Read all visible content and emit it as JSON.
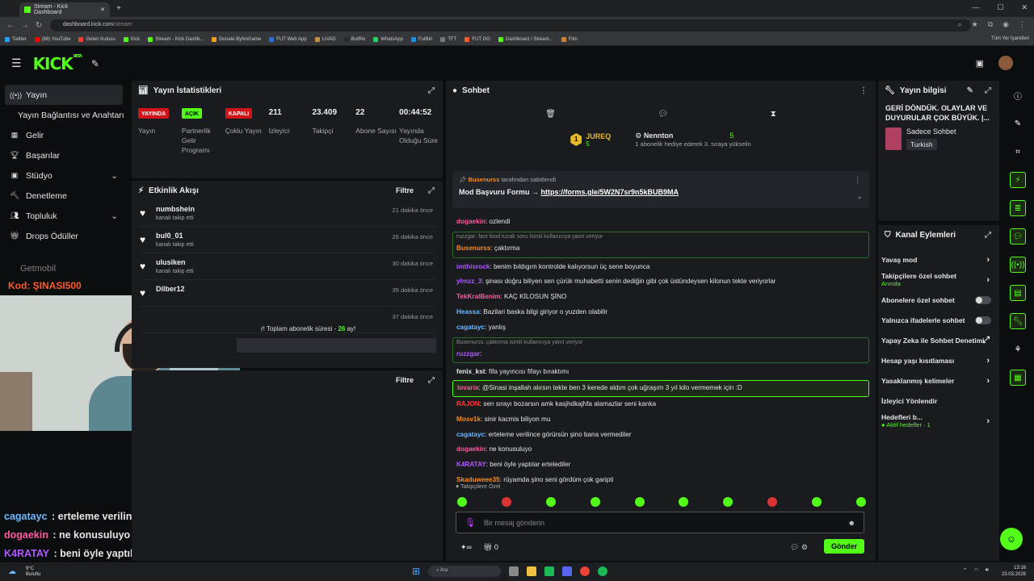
{
  "browser": {
    "tab_title": "Stream - Kick Dashboard",
    "url_host": "dashboard.kick.com",
    "url_path": "/stream",
    "bookmarks": [
      "Twitter",
      "(88) YouTube",
      "Gelen Kutusu",
      "Kick",
      "Stream - Kick Dashb...",
      "Donate ByNoGame",
      "FUT Web App",
      "LIVAD",
      "BotRix",
      "WhatsApp",
      "FutBin",
      "TFT",
      "FUT GG",
      "Dashboard / Stream...",
      "Film"
    ],
    "all_bookmarks": "Tüm Yer İşaretleri"
  },
  "header": {
    "logo": "KICK",
    "beta": "BETA"
  },
  "sidebar": {
    "items": [
      {
        "label": "Yayın",
        "icon": "broadcast-icon"
      },
      {
        "label": "Yayın Bağlantısı ve Anahtarı",
        "icon": ""
      },
      {
        "label": "Gelir",
        "icon": "revenue-icon"
      },
      {
        "label": "Başarılar",
        "icon": "trophy-icon"
      },
      {
        "label": "Stüdyo",
        "icon": "studio-icon"
      },
      {
        "label": "Denetleme",
        "icon": "hammer-icon"
      },
      {
        "label": "Topluluk",
        "icon": "community-icon"
      },
      {
        "label": "Drops Ödüller",
        "icon": "gift-icon"
      }
    ],
    "promo_brand": "Getmobil",
    "promo_code": "Kod: ŞINASI500"
  },
  "overlay_chat": [
    {
      "user": "cagatayc",
      "text": " : erteleme verilince görürsün şino bana vermediler",
      "color": "#6fb7ff"
    },
    {
      "user": "dogaekin",
      "text": " : ne konusuluyo",
      "color": "#ff5aa0"
    },
    {
      "user": "K4RATAY",
      "text": " : beni öyle yaptılar ertelediler",
      "color": "#b05aff"
    }
  ],
  "stats": {
    "title": "Yayın İstatistikleri",
    "items": [
      {
        "value": "YAYINDA",
        "label": "Yayın"
      },
      {
        "value": "AÇIK",
        "label": "Partnerlik Gelir Programı"
      },
      {
        "value": "KAPALI",
        "label": "Çoklu Yayın"
      },
      {
        "value": "211",
        "label": "İzleyici"
      },
      {
        "value": "23.409",
        "label": "Takipçi"
      },
      {
        "value": "22",
        "label": "Abone Sayısı"
      },
      {
        "value": "00:44:52",
        "label": "Yayında Olduğu Süre"
      }
    ]
  },
  "activity": {
    "title": "Etkinlik Akışı",
    "filter": "Filtre",
    "items": [
      {
        "name": "numbshein",
        "sub": "kanalı takip etti",
        "time": "21 dakika önce"
      },
      {
        "name": "bul0_01",
        "sub": "kanalı takip etti",
        "time": "26 dakika önce"
      },
      {
        "name": "ulusiken",
        "sub": "kanalı takip etti",
        "time": "30 dakika önce"
      },
      {
        "name": "Dilber12",
        "sub": "",
        "time": "35 dakika önce"
      },
      {
        "name": "",
        "sub": "",
        "time": "37 dakika önce"
      }
    ],
    "sub_text": "r! Toplam abonelik süresi - ",
    "sub_count": "26",
    "sub_tail": " ay!"
  },
  "panel3": {
    "filter": "Filtre"
  },
  "chat": {
    "title": "Sohbet",
    "leader1": {
      "rank": "1",
      "name": "JUREQ",
      "count": "5"
    },
    "leader2": {
      "name": "Nennton",
      "count": "5",
      "sub": "1 abonelik hediye ederek 3. sıraya yükselin"
    },
    "pinned_by": "Busenurss",
    "pinned_by_suffix": " tarafından sabitlendi",
    "pinned_text": "Mod Başvuru Formu → ",
    "pinned_link": "https://forms.gle/5W2N7sr9n5kBUB9MA",
    "messages": [
      {
        "user": "dogaekin",
        "text": ": ozlendi",
        "color": "#ff5aa0",
        "kind": "normal"
      },
      {
        "reply": "ruzzgar: fast food tuzak soru İsimli kullanıcıya yanıt veriyor",
        "user": "Busenurss",
        "text": ": çaktırma",
        "color": "#ff8c1a",
        "kind": "reply"
      },
      {
        "user": "imthisrock",
        "text": ": benim bıldıgım kontrolde kalıyorsun üç sene boyunca",
        "color": "#b05aff",
        "kind": "normal"
      },
      {
        "user": "ylmzz_3",
        "text": ": şinası doğru biliyen sen çürük muhabetti senin dediğin gibi çok üstündeysen kilonun tekte veriyorlar",
        "color": "#b05aff",
        "kind": "normal"
      },
      {
        "user": "TekKralBenim",
        "text": ": KAÇ KİLOSUN ŞİNO",
        "color": "#ff5aa0",
        "kind": "normal"
      },
      {
        "user": "Heassa",
        "text": ": Bazilari baska bilgi giriyor o yuzden olabilir",
        "color": "#6fb7ff",
        "kind": "normal"
      },
      {
        "user": "cagatayc",
        "text": ": yanlış",
        "color": "#6fb7ff",
        "kind": "normal"
      },
      {
        "reply": "Busenurss: çaktırma isimli kullanıcıya yanıt veriyor",
        "user": "ruzzgar",
        "text": ":",
        "color": "#b05aff",
        "kind": "reply"
      },
      {
        "user": "fenix_kst",
        "text": ": fifa yayıncısı fifayı bıraktımı",
        "color": "#e6e6e6",
        "kind": "normal"
      },
      {
        "user": "lovaria",
        "text": ": @Sinasi inşallah alırsın tekte ben 3 kerede aldım çok uğraşım 3 yıl kilo vermemek için :D",
        "color": "#ff5aa0",
        "kind": "mention"
      },
      {
        "user": "RAJON",
        "text": ": sen sırayı bozarsın amk kasjhdkajhfa alamazlar seni kanka",
        "color": "#ff3a3a",
        "kind": "normal"
      },
      {
        "user": "Mosv1k",
        "text": ": sinir kacmis biliyon mu",
        "color": "#ff8c1a",
        "kind": "normal"
      },
      {
        "user": "cagatayc",
        "text": ": erteleme verilince görürsün şino bana vermediler",
        "color": "#6fb7ff",
        "kind": "normal"
      },
      {
        "user": "dogaekin",
        "text": ": ne konusuluyo",
        "color": "#ff5aa0",
        "kind": "normal"
      },
      {
        "user": "K4RATAY",
        "text": ": beni öyle yaptılar ertelediler",
        "color": "#b05aff",
        "kind": "normal"
      },
      {
        "user": "Skaduweee35",
        "text": ": rüyamda şino seni gördüm çok garipti",
        "color": "#ff8c1a",
        "kind": "normal"
      }
    ],
    "followers_only": "Takipçilere Özel",
    "input_placeholder": "Bir mesaj gönderin",
    "count": "0",
    "send": "Gönder"
  },
  "info": {
    "title": "Yayın bilgisi",
    "stream_title": "GERİ DÖNDÜK. OLAYLAR VE DUYURULAR ÇOK BÜYÜK. |...",
    "category": "Sadece Sohbet",
    "language": "Turkish"
  },
  "actions": {
    "title": "Kanal Eylemleri",
    "items": [
      {
        "label": "Yavaş mod",
        "extra": "",
        "type": "arrow"
      },
      {
        "label": "Takipçilere özel sohbet",
        "extra": "Anında",
        "type": "arrow"
      },
      {
        "label": "Abonelere özel sohbet",
        "extra": "",
        "type": "toggle"
      },
      {
        "label": "Yalnızca ifadelerle sohbet",
        "extra": "",
        "type": "toggle"
      },
      {
        "label": "Yapay Zeka ile Sohbet Denetimi",
        "extra": "",
        "type": "ext"
      },
      {
        "label": "Hesap yaşı kısıtlaması",
        "extra": "",
        "type": "arrow"
      },
      {
        "label": "Yasaklanmış kelimeler",
        "extra": "",
        "type": "arrow"
      },
      {
        "label": "İzleyici Yönlendir",
        "extra": "",
        "type": "none"
      },
      {
        "label": "Hedefleri b...",
        "extra": "● Aktif hedefler · 1",
        "type": "arrow"
      }
    ]
  },
  "taskbar": {
    "temp": "9°C",
    "weather": "Bulutlu",
    "search": "Ara",
    "time": "13:16",
    "date": "23.03.2026"
  },
  "colors": {
    "accent": "#53fc18",
    "live": "#d0141a",
    "panel": "#191b1f"
  }
}
